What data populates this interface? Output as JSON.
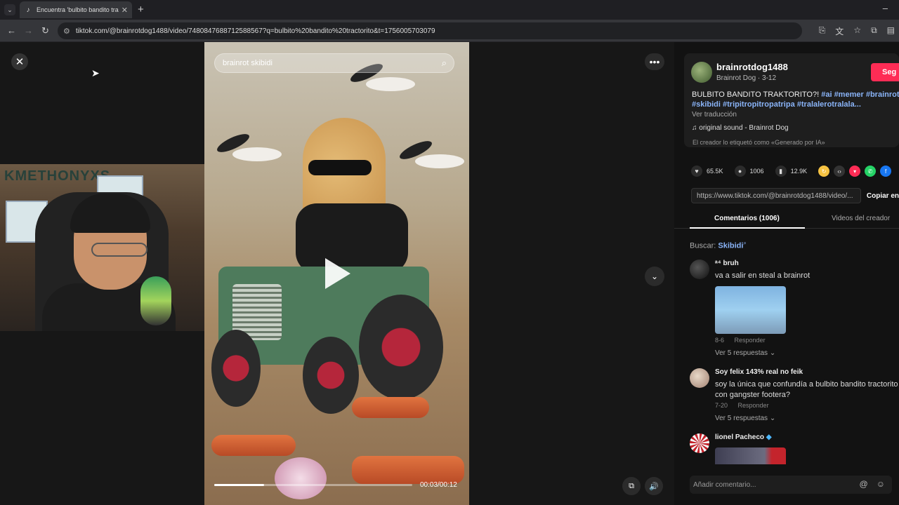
{
  "browser": {
    "tab_title": "Encuentra 'bulbito bandito trac",
    "url": "tiktok.com/@brainrotdog1488/video/7480847688712588567?q=bulbito%20bandito%20tractorito&t=1756005703079"
  },
  "player": {
    "search_value": "brainrot skibidi",
    "time": "00:03/00:12",
    "progress_fraction": 0.25
  },
  "author": {
    "username": "brainrotdog1488",
    "nickname": "Brainrot Dog · 3-12",
    "follow_label": "Seg",
    "desc_text": "BULBITO BANDITO TRAKTORITO?! ",
    "hashtags": [
      "#ai",
      "#memer",
      "#brainrot",
      "#skibidi",
      "#tripitropitropatripa",
      "#tralalerotralala..."
    ],
    "translate": "Ver traducción",
    "sound": "original sound - Brainrot Dog",
    "ai_label": "El creador lo etiquetó como «Generado por IA»"
  },
  "stats": {
    "likes": "65.5K",
    "comments": "1006",
    "saves": "12.9K"
  },
  "link": {
    "url": "https://www.tiktok.com/@brainrotdog1488/video/...",
    "copy_label": "Copiar en"
  },
  "tabs": {
    "comments": "Comentarios (1006)",
    "creator_videos": "Videos del creador"
  },
  "search_hint": {
    "label": "Buscar:",
    "query": "Skibidi"
  },
  "comments": [
    {
      "name": "ᵃ⁴ bruh",
      "text": "va a salir en steal a brainrot",
      "date": "8-6",
      "reply": "Responder",
      "replies": "Ver 5 respuestas"
    },
    {
      "name": "Soy felix 143% real no feik",
      "text": "soy la única que confundía a bulbito bandito tractorito con gangster footera?",
      "date": "7-20",
      "reply": "Responder",
      "replies": "Ver 5 respuestas"
    },
    {
      "name": "lionel Pacheco",
      "text": "",
      "date": "",
      "reply": "",
      "replies": ""
    }
  ],
  "comment_input": {
    "placeholder": "Añadir comentario..."
  },
  "colors": {
    "follow": "#fe2c55",
    "hashtag": "#8ab4f8"
  }
}
